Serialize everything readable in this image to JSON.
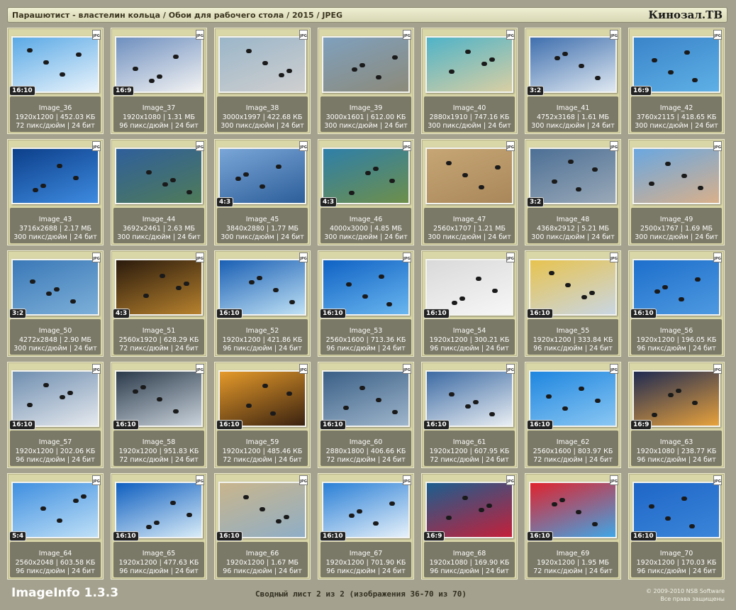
{
  "header": {
    "path": "Парашютист - властелин кольца / Обои для рабочего стола / 2015 / JPEG",
    "brand": "Кинозал.ТВ"
  },
  "file_badge": "JPG",
  "images": [
    {
      "name": "Image_36",
      "dims": "1920x1200 | 452.03 КБ",
      "meta": "72 пикс/дюйм | 24 бит",
      "ratio": "16:10",
      "colors": [
        "#5aa9e6",
        "#e8f3fb"
      ]
    },
    {
      "name": "Image_37",
      "dims": "1920x1080 | 1.31 МБ",
      "meta": "96 пикс/дюйм | 24 бит",
      "ratio": "16:9",
      "colors": [
        "#6e8fbf",
        "#f3f3f3"
      ]
    },
    {
      "name": "Image_38",
      "dims": "3000x1997 | 422.68 КБ",
      "meta": "300 пикс/дюйм | 24 бит",
      "ratio": "",
      "colors": [
        "#9bb6c9",
        "#cfcfcf"
      ]
    },
    {
      "name": "Image_39",
      "dims": "3000x1601 | 612.00 КБ",
      "meta": "300 пикс/дюйм | 24 бит",
      "ratio": "",
      "colors": [
        "#7fa0bd",
        "#8c8a7a"
      ]
    },
    {
      "name": "Image_40",
      "dims": "2880x1910 | 747.16 КБ",
      "meta": "300 пикс/дюйм | 24 бит",
      "ratio": "",
      "colors": [
        "#4fb3c8",
        "#d9cfa3"
      ]
    },
    {
      "name": "Image_41",
      "dims": "4752x3168 | 1.61 МБ",
      "meta": "300 пикс/дюйм | 24 бит",
      "ratio": "3:2",
      "colors": [
        "#3f6fae",
        "#dfe8f1"
      ]
    },
    {
      "name": "Image_42",
      "dims": "3760x2115 | 418.65 КБ",
      "meta": "300 пикс/дюйм | 24 бит",
      "ratio": "16:9",
      "colors": [
        "#3a84c9",
        "#5fb0e6"
      ]
    },
    {
      "name": "Image_43",
      "dims": "3716x2688 | 2.17 МБ",
      "meta": "300 пикс/дюйм | 24 бит",
      "ratio": "",
      "colors": [
        "#0c3f8a",
        "#3e8be0"
      ]
    },
    {
      "name": "Image_44",
      "dims": "3692x2461 | 2.63 МБ",
      "meta": "300 пикс/дюйм | 24 бит",
      "ratio": "",
      "colors": [
        "#2f5f9b",
        "#4f7b58"
      ]
    },
    {
      "name": "Image_45",
      "dims": "3840x2880 | 1.77 МБ",
      "meta": "300 пикс/дюйм | 24 бит",
      "ratio": "4:3",
      "colors": [
        "#7aa6d8",
        "#2d5e99"
      ]
    },
    {
      "name": "Image_46",
      "dims": "4000x3000 | 4.85 МБ",
      "meta": "300 пикс/дюйм | 24 бит",
      "ratio": "4:3",
      "colors": [
        "#2e7fa9",
        "#6e8f4a"
      ]
    },
    {
      "name": "Image_47",
      "dims": "2560x1707 | 1.21 МБ",
      "meta": "300 пикс/дюйм | 24 бит",
      "ratio": "",
      "colors": [
        "#c7a675",
        "#a9875a"
      ]
    },
    {
      "name": "Image_48",
      "dims": "4368x2912 | 5.21 МБ",
      "meta": "300 пикс/дюйм | 24 бит",
      "ratio": "3:2",
      "colors": [
        "#4c6f95",
        "#9aa9b8"
      ]
    },
    {
      "name": "Image_49",
      "dims": "2500x1767 | 1.69 МБ",
      "meta": "300 пикс/дюйм | 24 бит",
      "ratio": "",
      "colors": [
        "#6aa7e0",
        "#d9b08a"
      ]
    },
    {
      "name": "Image_50",
      "dims": "4272x2848 | 2.90 МБ",
      "meta": "300 пикс/дюйм | 24 бит",
      "ratio": "3:2",
      "colors": [
        "#3a78b7",
        "#7db0d9"
      ]
    },
    {
      "name": "Image_51",
      "dims": "2560x1920 | 628.29 КБ",
      "meta": "72 пикс/дюйм | 24 бит",
      "ratio": "4:3",
      "colors": [
        "#2a1a0c",
        "#b7822e"
      ]
    },
    {
      "name": "Image_52",
      "dims": "1920x1200 | 421.86 КБ",
      "meta": "96 пикс/дюйм | 24 бит",
      "ratio": "16:10",
      "colors": [
        "#1a5fb4",
        "#bfe1f5"
      ]
    },
    {
      "name": "Image_53",
      "dims": "2560x1600 | 713.36 КБ",
      "meta": "96 пикс/дюйм | 24 бит",
      "ratio": "16:10",
      "colors": [
        "#0f62c4",
        "#6ab6ef"
      ]
    },
    {
      "name": "Image_54",
      "dims": "1920x1200 | 300.21 КБ",
      "meta": "96 пикс/дюйм | 24 бит",
      "ratio": "16:10",
      "colors": [
        "#d9d9d9",
        "#f7f7f7"
      ]
    },
    {
      "name": "Image_55",
      "dims": "1920x1200 | 333.84 КБ",
      "meta": "96 пикс/дюйм | 24 бит",
      "ratio": "16:10",
      "colors": [
        "#e7c34f",
        "#c9d6e3"
      ]
    },
    {
      "name": "Image_56",
      "dims": "1920x1200 | 196.05 КБ",
      "meta": "96 пикс/дюйм | 24 бит",
      "ratio": "16:10",
      "colors": [
        "#1d6fcc",
        "#4e99e0"
      ]
    },
    {
      "name": "Image_57",
      "dims": "1920x1200 | 202.06 КБ",
      "meta": "96 пикс/дюйм | 24 бит",
      "ratio": "16:10",
      "colors": [
        "#6f8eb0",
        "#e5e9ee"
      ]
    },
    {
      "name": "Image_58",
      "dims": "1920x1200 | 951.83 КБ",
      "meta": "72 пикс/дюйм | 24 бит",
      "ratio": "16:10",
      "colors": [
        "#2b3a4a",
        "#c9d3dc"
      ]
    },
    {
      "name": "Image_59",
      "dims": "1920x1200 | 485.46 КБ",
      "meta": "72 пикс/дюйм | 24 бит",
      "ratio": "16:10",
      "colors": [
        "#e59a2a",
        "#3a2210"
      ]
    },
    {
      "name": "Image_60",
      "dims": "2880x1800 | 406.66 КБ",
      "meta": "72 пикс/дюйм | 24 бит",
      "ratio": "16:10",
      "colors": [
        "#3a5f86",
        "#9fb6cc"
      ]
    },
    {
      "name": "Image_61",
      "dims": "1920x1200 | 607.95 КБ",
      "meta": "72 пикс/дюйм | 24 бит",
      "ratio": "16:10",
      "colors": [
        "#3c6aa3",
        "#e9eef3"
      ]
    },
    {
      "name": "Image_62",
      "dims": "2560x1600 | 803.97 КБ",
      "meta": "72 пикс/дюйм | 24 бит",
      "ratio": "16:10",
      "colors": [
        "#1f86df",
        "#8ac7f3"
      ]
    },
    {
      "name": "Image_63",
      "dims": "1920x1080 | 238.77 КБ",
      "meta": "96 пикс/дюйм | 24 бит",
      "ratio": "16:9",
      "colors": [
        "#1f2a52",
        "#e8a23c"
      ]
    },
    {
      "name": "Image_64",
      "dims": "2560x2048 | 603.58 КБ",
      "meta": "96 пикс/дюйм | 24 бит",
      "ratio": "5:4",
      "colors": [
        "#3f8fe0",
        "#bfe0f7"
      ]
    },
    {
      "name": "Image_65",
      "dims": "1920x1200 | 477.63 КБ",
      "meta": "96 пикс/дюйм | 24 бит",
      "ratio": "16:10",
      "colors": [
        "#0f5fc0",
        "#d9ecf8"
      ]
    },
    {
      "name": "Image_66",
      "dims": "1920x1200 | 1.67 МБ",
      "meta": "96 пикс/дюйм | 24 бит",
      "ratio": "16:10",
      "colors": [
        "#c9b58c",
        "#8faec6"
      ]
    },
    {
      "name": "Image_67",
      "dims": "1920x1200 | 701.90 КБ",
      "meta": "96 пикс/дюйм | 24 бит",
      "ratio": "16:10",
      "colors": [
        "#2a7fd6",
        "#e6f1fa"
      ]
    },
    {
      "name": "Image_68",
      "dims": "1920x1080 | 169.90 КБ",
      "meta": "96 пикс/дюйм | 24 бит",
      "ratio": "16:9",
      "colors": [
        "#1b5e8f",
        "#c4203a"
      ]
    },
    {
      "name": "Image_69",
      "dims": "1920x1200 | 1.95 МБ",
      "meta": "72 пикс/дюйм | 24 бит",
      "ratio": "16:10",
      "colors": [
        "#e0232d",
        "#3fa6e6"
      ]
    },
    {
      "name": "Image_70",
      "dims": "1920x1200 | 170.03 КБ",
      "meta": "96 пикс/дюйм | 24 бит",
      "ratio": "16:10",
      "colors": [
        "#1f66c6",
        "#3b86da"
      ]
    }
  ],
  "footer": {
    "app": "ImageInfo 1.3.3",
    "summary": "Сводный лист 2 из 2 (изображения 36-70 из 70)",
    "copyright": "© 2009-2010 NSB Software",
    "rights": "Все права защищены"
  }
}
